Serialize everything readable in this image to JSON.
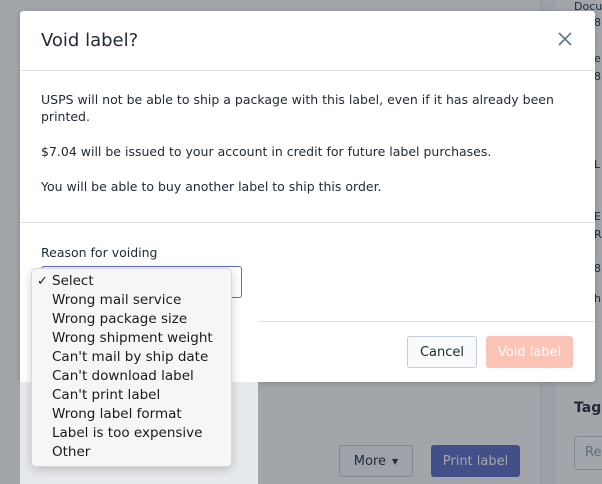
{
  "background": {
    "right_snippets": [
      "Docu",
      "8",
      "e",
      "8",
      "L",
      "E",
      "R",
      "8",
      "h"
    ],
    "more_label": "More",
    "print_label": "Print label",
    "tags_label": "Tag",
    "tags_placeholder": "Re"
  },
  "modal": {
    "title": "Void label?",
    "paragraphs": [
      "USPS will not be able to ship a package with this label, even if it has already been printed.",
      "$7.04 will be issued to your account in credit for future label purchases.",
      "You will be able to buy another label to ship this order."
    ],
    "reason_label": "Reason for voiding",
    "cancel_label": "Cancel",
    "void_label": "Void label"
  },
  "dropdown": {
    "selected_index": 0,
    "options": [
      "Select",
      "Wrong mail service",
      "Wrong package size",
      "Wrong shipment weight",
      "Can't mail by ship date",
      "Can't download label",
      "Can't print label",
      "Wrong label format",
      "Label is too expensive",
      "Other"
    ]
  },
  "colors": {
    "primary": "#5c6ac4",
    "destructive_disabled": "#fbc4b6"
  }
}
